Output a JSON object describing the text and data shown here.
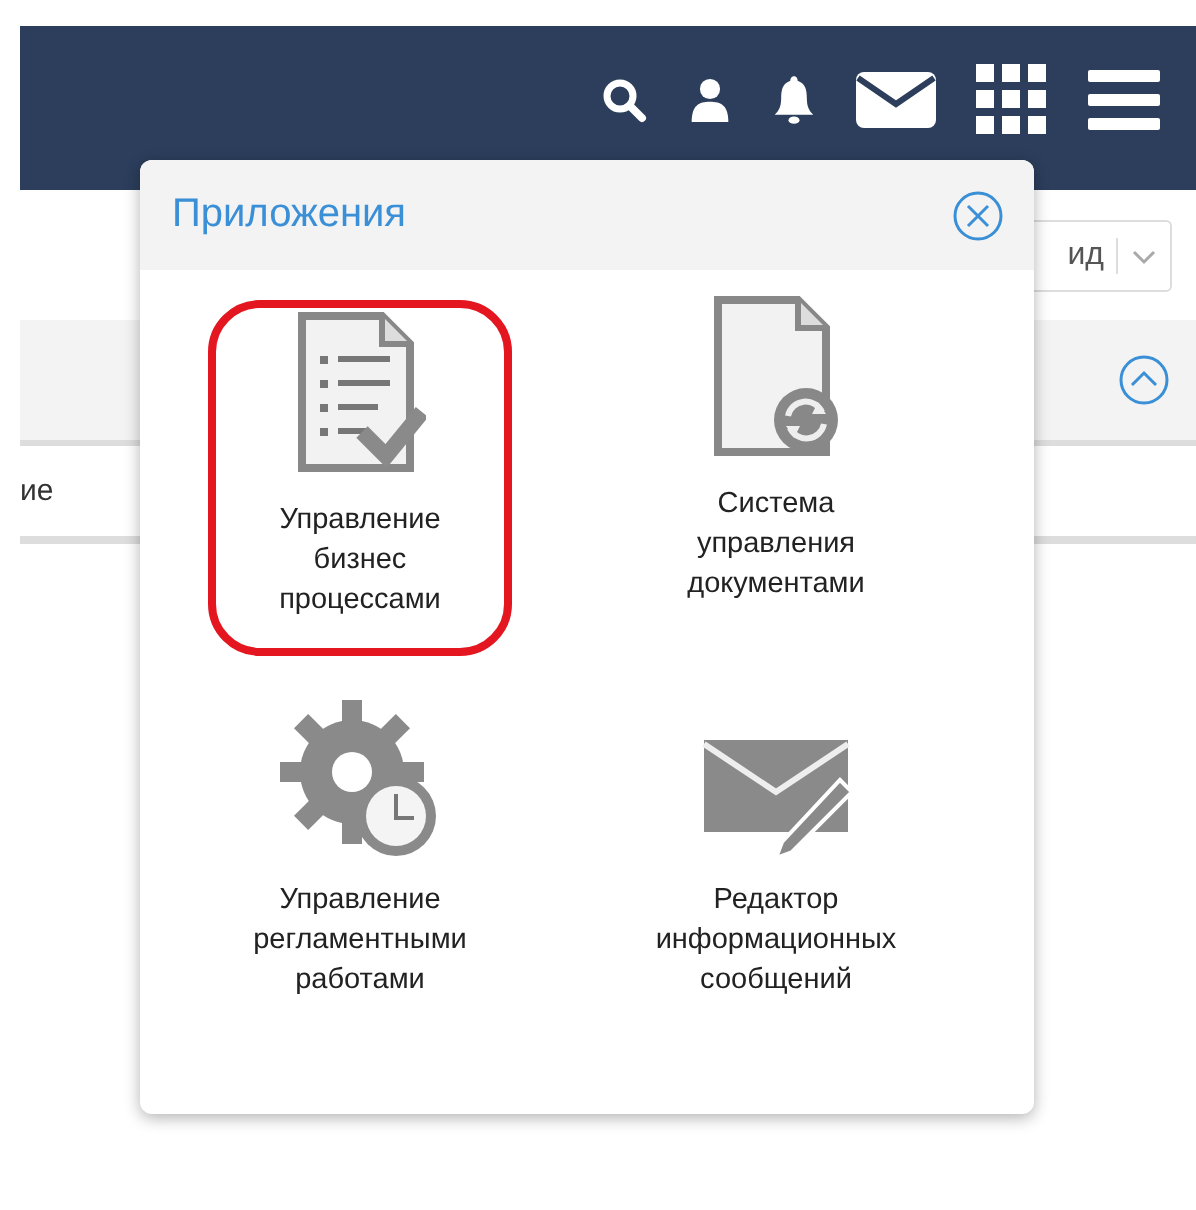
{
  "toolbar": {
    "view_select": {
      "value": "ид"
    }
  },
  "section": {
    "expanded": true
  },
  "table": {
    "rows": [
      {
        "cell": "ие"
      }
    ]
  },
  "apps_popup": {
    "title": "Приложения",
    "apps": [
      {
        "kind": "process",
        "label": "Управление\nбизнес\nпроцессами",
        "highlighted": true
      },
      {
        "kind": "documents",
        "label": "Система\nуправления\nдокументами",
        "highlighted": false
      },
      {
        "kind": "schedule",
        "label": "Управление\nрегламентными\nработами",
        "highlighted": false
      },
      {
        "kind": "messages",
        "label": "Редактор\nинформационных\nсообщений",
        "highlighted": false
      }
    ]
  }
}
